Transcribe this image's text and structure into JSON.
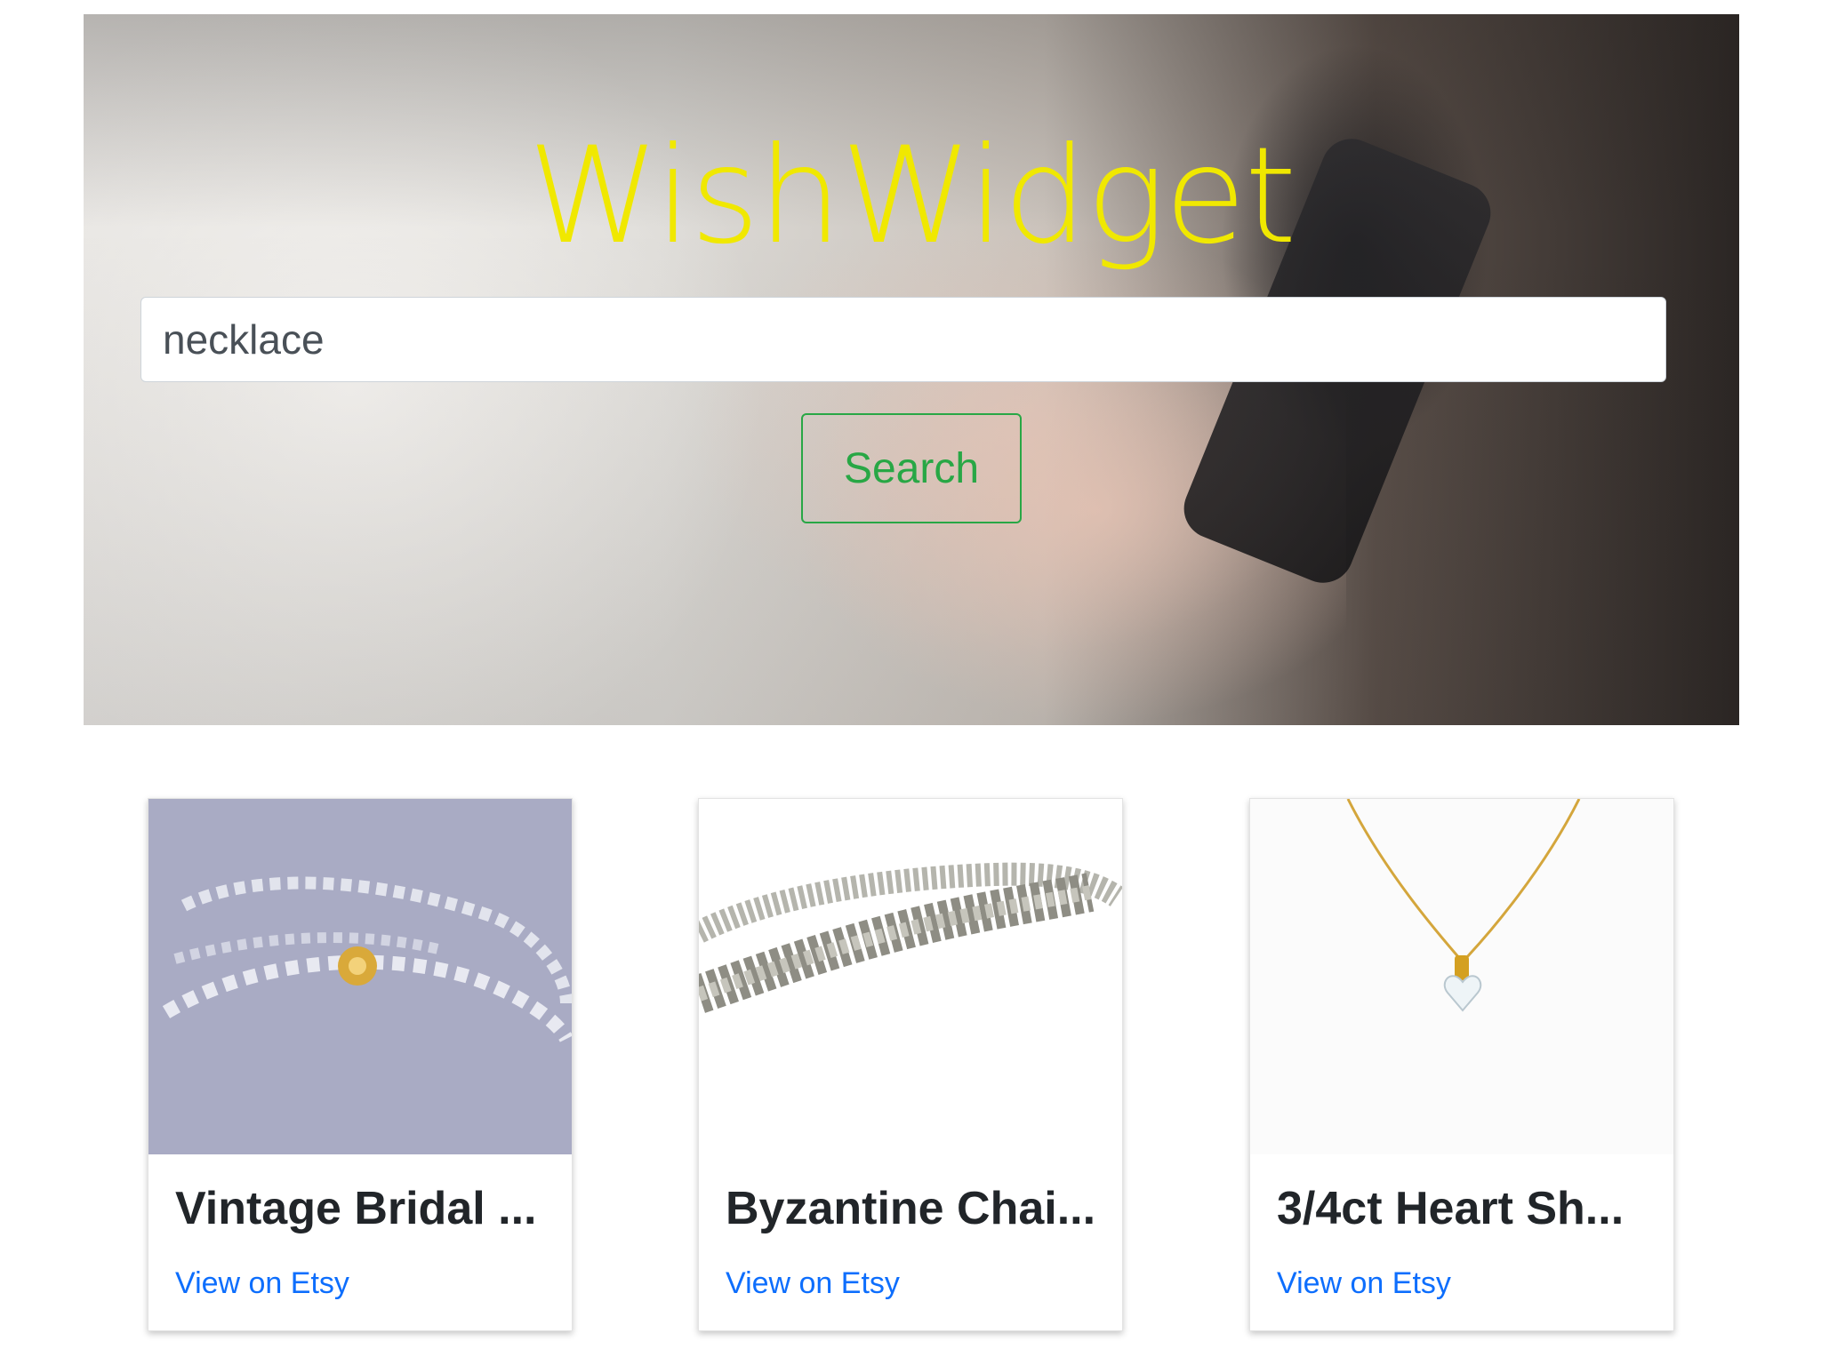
{
  "hero": {
    "title": "WishWidget",
    "search_value": "necklace",
    "search_button_label": "Search",
    "title_color": "#f0e800",
    "button_color": "#28a745"
  },
  "results": [
    {
      "title": "Vintage Bridal ...",
      "link_label": "View on Etsy",
      "image": "crystal-bead-necklace"
    },
    {
      "title": "Byzantine Chai...",
      "link_label": "View on Etsy",
      "image": "chainmaille-bracelet"
    },
    {
      "title": "3/4ct Heart Sh...",
      "link_label": "View on Etsy",
      "image": "heart-pendant-necklace"
    }
  ],
  "link_color": "#0d6efd"
}
